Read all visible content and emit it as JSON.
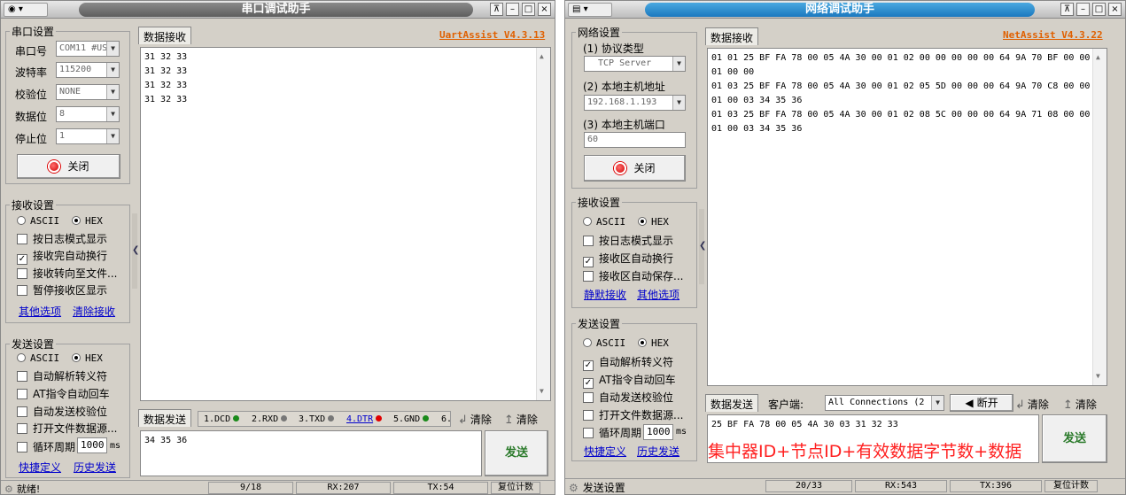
{
  "uart": {
    "title": "串口调试助手",
    "version": "UartAssist V4.3.13",
    "serial_group": {
      "title": "串口设置",
      "port_label": "串口号",
      "port_value": "COM11 #US",
      "baud_label": "波特率",
      "baud_value": "115200",
      "parity_label": "校验位",
      "parity_value": "NONE",
      "databits_label": "数据位",
      "databits_value": "8",
      "stopbits_label": "停止位",
      "stopbits_value": "1",
      "close_button": "关闭"
    },
    "recv_group": {
      "title": "接收设置",
      "ascii": "ASCII",
      "hex": "HEX",
      "opts": [
        {
          "label": "按日志模式显示",
          "checked": false
        },
        {
          "label": "接收完自动换行",
          "checked": true
        },
        {
          "label": "接收转向至文件...",
          "checked": false
        },
        {
          "label": "暂停接收区显示",
          "checked": false
        }
      ],
      "link_more": "其他选项",
      "link_clear": "清除接收"
    },
    "send_group": {
      "title": "发送设置",
      "ascii": "ASCII",
      "hex": "HEX",
      "opts": [
        {
          "label": "自动解析转义符",
          "checked": false
        },
        {
          "label": "AT指令自动回车",
          "checked": false
        },
        {
          "label": "自动发送校验位",
          "checked": false
        },
        {
          "label": "打开文件数据源...",
          "checked": false
        }
      ],
      "loop_label": "循环周期",
      "loop_value": "1000",
      "loop_unit": "ms",
      "link_shortcut": "快捷定义",
      "link_history": "历史发送"
    },
    "recv_tab": "数据接收",
    "recv_text": "31 32 33\n31 32 33\n31 32 33\n31 32 33",
    "send_tab": "数据发送",
    "signals": {
      "dcd": "1.DCD",
      "rxd": "2.RXD",
      "txd": "3.TXD",
      "dtr": "4.DTR",
      "gnd": "5.GND",
      "six": "6."
    },
    "clear1": "清除",
    "clear2": "清除",
    "send_text": "34 35 36",
    "send_button": "发送",
    "status": {
      "ready": "就绪!",
      "count": "9/18",
      "rx": "RX:207",
      "tx": "TX:54",
      "reset": "复位计数"
    }
  },
  "net": {
    "title": "网络调试助手",
    "version": "NetAssist V4.3.22",
    "net_group": {
      "title": "网络设置",
      "proto_label": "(1) 协议类型",
      "proto_value": "TCP Server",
      "host_label": "(2) 本地主机地址",
      "host_value": "192.168.1.193",
      "port_label": "(3) 本地主机端口",
      "port_value": "60",
      "close_button": "关闭"
    },
    "recv_group": {
      "title": "接收设置",
      "ascii": "ASCII",
      "hex": "HEX",
      "opts": [
        {
          "label": "按日志模式显示",
          "checked": false
        },
        {
          "label": "接收区自动换行",
          "checked": true
        },
        {
          "label": "接收区自动保存...",
          "checked": false
        }
      ],
      "link_silent": "静默接收",
      "link_more": "其他选项"
    },
    "send_group": {
      "title": "发送设置",
      "ascii": "ASCII",
      "hex": "HEX",
      "opts": [
        {
          "label": "自动解析转义符",
          "checked": true
        },
        {
          "label": "AT指令自动回车",
          "checked": true
        },
        {
          "label": "自动发送校验位",
          "checked": false
        },
        {
          "label": "打开文件数据源...",
          "checked": false
        }
      ],
      "loop_label": "循环周期",
      "loop_value": "1000",
      "loop_unit": "ms",
      "link_shortcut": "快捷定义",
      "link_history": "历史发送"
    },
    "recv_tab": "数据接收",
    "recv_text": "01 01 25 BF FA 78 00 05 4A 30 00 01 02 00 00 00 00 00 64 9A 70 BF 00 00\n01 00 00\n01 03 25 BF FA 78 00 05 4A 30 00 01 02 05 5D 00 00 00 64 9A 70 C8 00 00\n01 00 03 34 35 36\n01 03 25 BF FA 78 00 05 4A 30 00 01 02 08 5C 00 00 00 64 9A 71 08 00 00\n01 00 03 34 35 36",
    "send_tab": "数据发送",
    "client_label": "客户端:",
    "client_value": "All Connections (2",
    "disconnect": "断开",
    "clear1": "清除",
    "clear2": "清除",
    "send_text": "25 BF FA 78 00 05 4A 30 03 31 32 33",
    "annotation": "集中器ID+节点ID+有效数据字节数+数据",
    "send_button": "发送",
    "status": {
      "send_settings": "发送设置",
      "count": "20/33",
      "rx": "RX:543",
      "tx": "TX:396",
      "reset": "复位计数"
    }
  }
}
